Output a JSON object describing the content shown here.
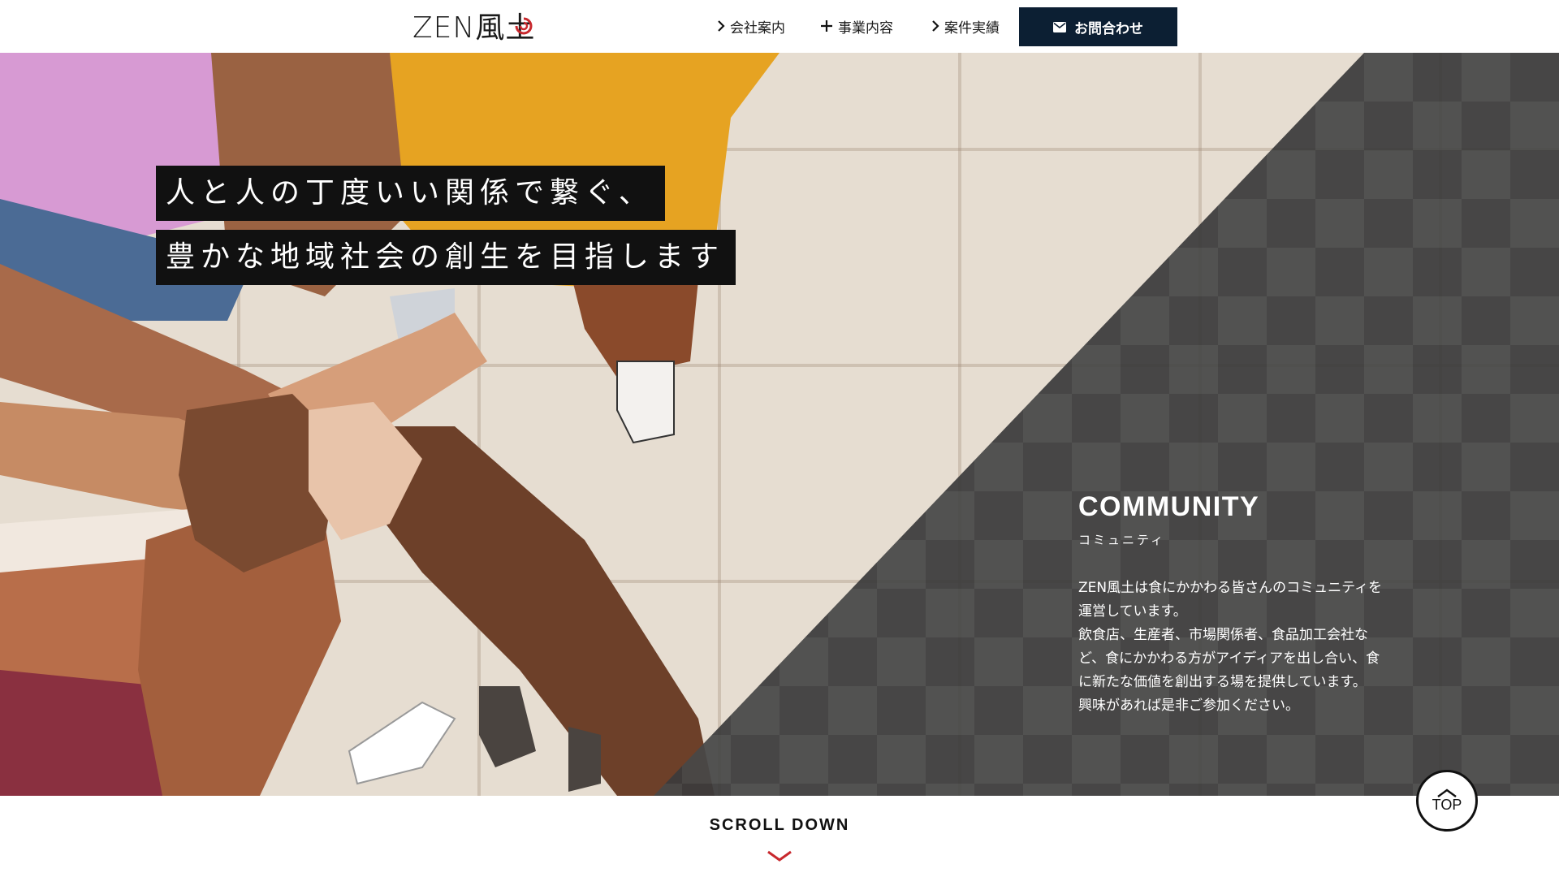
{
  "header": {
    "logo_text": "ZEN風土",
    "nav": [
      {
        "label": "会社案内",
        "icon": "chevron-right-icon"
      },
      {
        "label": "事業内容",
        "icon": "plus-icon"
      },
      {
        "label": "案件実績",
        "icon": "chevron-right-icon"
      }
    ],
    "contact_label": "お問合わせ",
    "contact_icon": "mail-icon"
  },
  "hero": {
    "tagline_line1": "人と人の丁度いい関係で繋ぐ、",
    "tagline_line2": "豊かな地域社会の創生を目指します",
    "section_title": "COMMUNITY",
    "section_subtitle": "コミュニティ",
    "section_body": [
      "ZEN風土は食にかかわる皆さんのコミュニティを",
      "運営しています。",
      "飲食店、生産者、市場関係者、食品加工会社な",
      "ど、食にかかわる方がアイディアを出し合い、食",
      "に新たな価値を創出する場を提供しています。",
      "興味があれば是非ご参加ください。"
    ]
  },
  "footer": {
    "scroll_label": "SCROLL DOWN",
    "top_label": "TOP"
  },
  "colors": {
    "accent_dark": "#0c1f33",
    "accent_red": "#c8282d",
    "overlay": "#3a3a3a"
  }
}
